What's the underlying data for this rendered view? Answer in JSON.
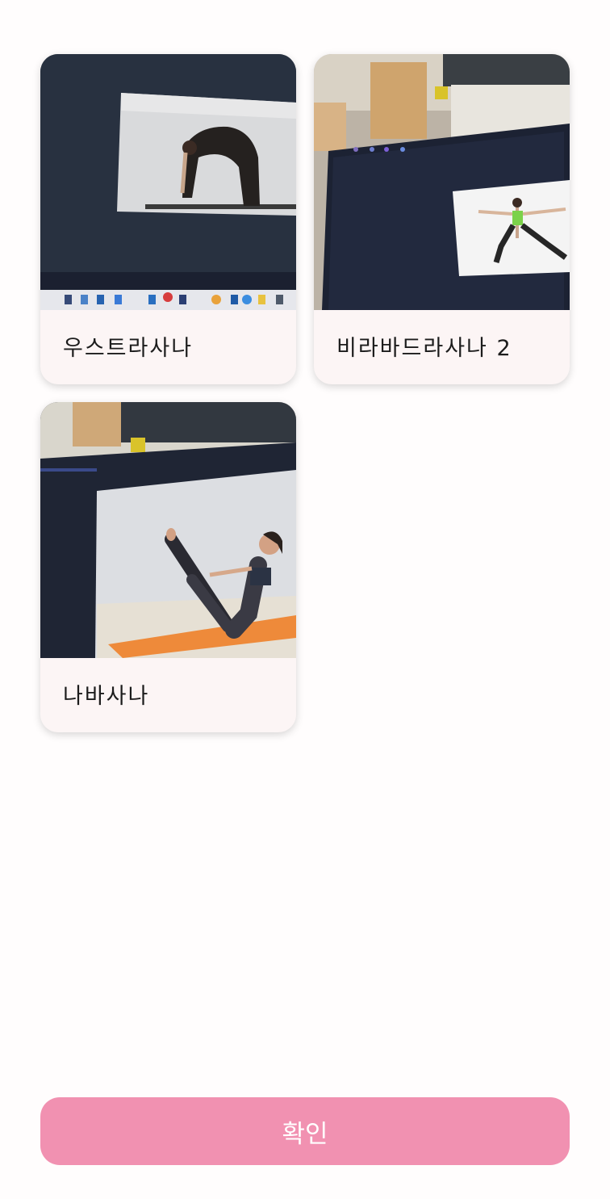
{
  "poses": [
    {
      "name": "우스트라사나",
      "image": "camel-pose-photo"
    },
    {
      "name": "비라바드라사나 2",
      "image": "warrior-two-pose-photo"
    },
    {
      "name": "나바사나",
      "image": "boat-pose-photo"
    }
  ],
  "confirm_label": "확인",
  "colors": {
    "background": "#fffdfd",
    "card": "#fcf5f5",
    "accent": "#f191b1"
  }
}
